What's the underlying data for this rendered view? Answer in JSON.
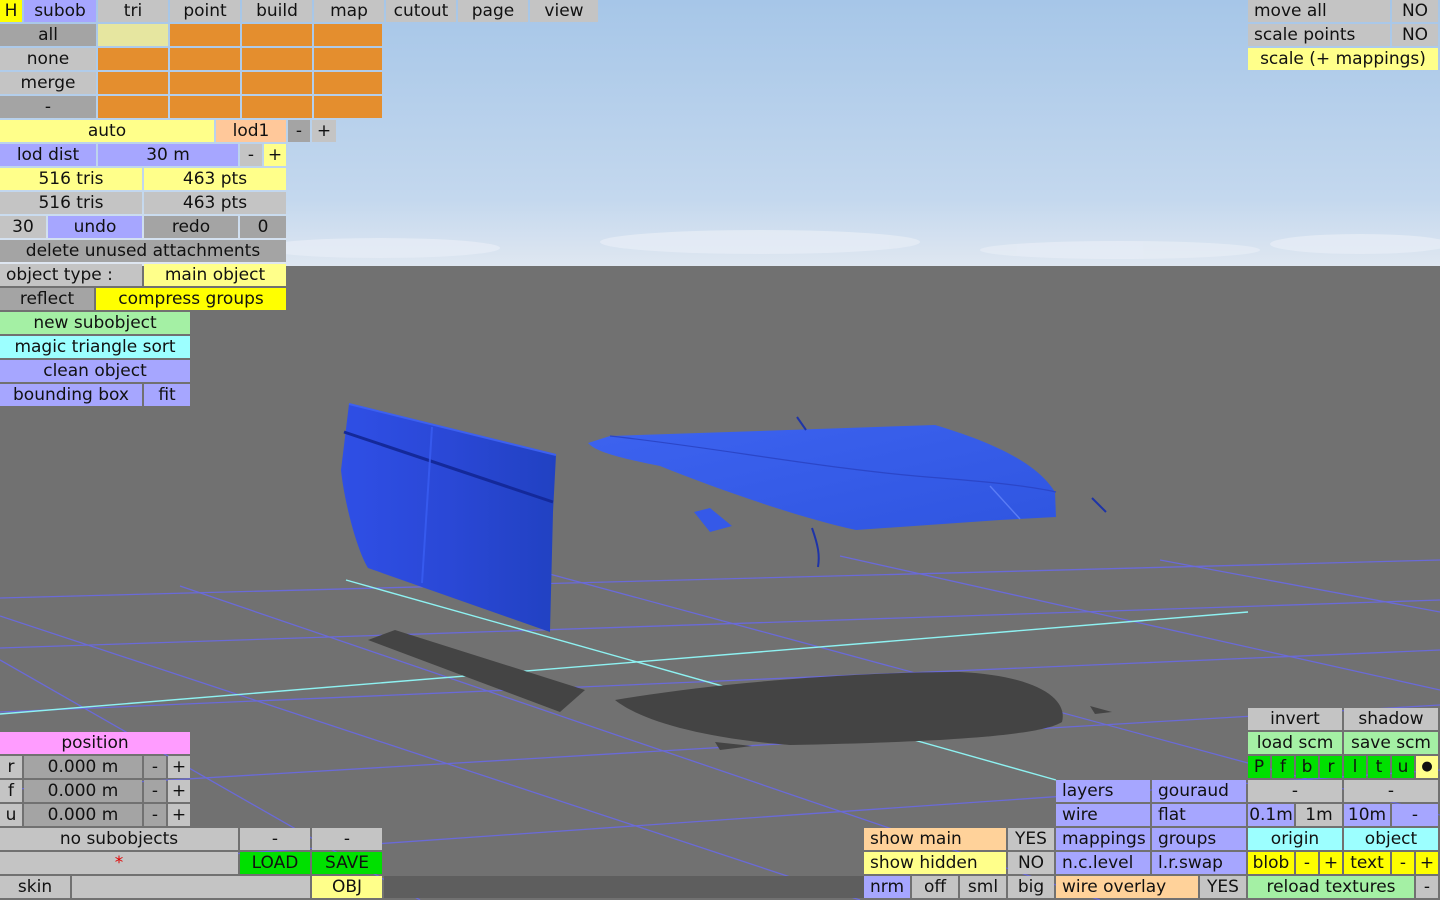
{
  "top_menu": {
    "h": "H",
    "subob": "subob",
    "tri": "tri",
    "point": "point",
    "build": "build",
    "map": "map",
    "cutout": "cutout",
    "page": "page",
    "view": "view"
  },
  "select": {
    "all": "all",
    "none": "none",
    "merge": "merge",
    "dash": "-"
  },
  "lod": {
    "auto": "auto",
    "name": "lod1",
    "minus": "-",
    "plus": "+",
    "dist_label": "lod dist",
    "dist_value": "30 m"
  },
  "stats": {
    "tris_a": "516 tris",
    "pts_a": "463 pts",
    "tris_b": "516 tris",
    "pts_b": "463 pts"
  },
  "history": {
    "undo_count": "30",
    "undo": "undo",
    "redo": "redo",
    "redo_count": "0"
  },
  "delete_unused": "delete unused attachments",
  "object_type": {
    "label": "object type :",
    "value": "main object"
  },
  "reflect": "reflect",
  "compress_groups": "compress groups",
  "new_subobject": "new subobject",
  "magic_sort": "magic triangle sort",
  "clean_object": "clean object",
  "bounding_box": {
    "label": "bounding box",
    "fit": "fit"
  },
  "top_right": {
    "move_all": "move all",
    "move_all_value": "NO",
    "scale_points": "scale points",
    "scale_points_value": "NO",
    "scale_mappings": "scale (+ mappings)"
  },
  "position": {
    "title": "position",
    "rows": [
      {
        "axis": "r",
        "value": "0.000 m"
      },
      {
        "axis": "f",
        "value": "0.000 m"
      },
      {
        "axis": "u",
        "value": "0.000 m"
      }
    ],
    "minus": "-",
    "plus": "+"
  },
  "subobjects": {
    "label": "no subobjects",
    "dash": "-",
    "star": "*",
    "load": "LOAD",
    "save": "SAVE",
    "skin": "skin",
    "obj": "OBJ"
  },
  "display": {
    "show_main": "show main",
    "show_main_value": "YES",
    "show_hidden": "show hidden",
    "show_hidden_value": "NO",
    "nrm": "nrm",
    "off": "off",
    "sml": "sml",
    "big": "big"
  },
  "render": {
    "layers": "layers",
    "gouraud": "gouraud",
    "wire": "wire",
    "flat": "flat",
    "mappings": "mappings",
    "groups": "groups",
    "nc_level": "n.c.level",
    "lr_swap": "l.r.swap",
    "wire_overlay": "wire overlay",
    "wire_overlay_value": "YES"
  },
  "right_bottom": {
    "invert": "invert",
    "shadow": "shadow",
    "load_scm": "load scm",
    "save_scm": "save scm",
    "views": [
      "P",
      "f",
      "b",
      "r",
      "l",
      "t",
      "u"
    ],
    "dot": "●",
    "dash": "-",
    "grid_01": "0.1m",
    "grid_1": "1m",
    "grid_10": "10m",
    "origin": "origin",
    "object": "object",
    "blob": "blob",
    "text": "text",
    "minus": "-",
    "plus": "+",
    "reload_textures": "reload textures"
  },
  "colors": {
    "sky_top": "#a9c8e8",
    "ground": "#717171",
    "model_blue": "#2a4bdb",
    "grid_line": "#6a6ad8",
    "axis_line": "#8ef2f2",
    "shadow": "#444444"
  }
}
